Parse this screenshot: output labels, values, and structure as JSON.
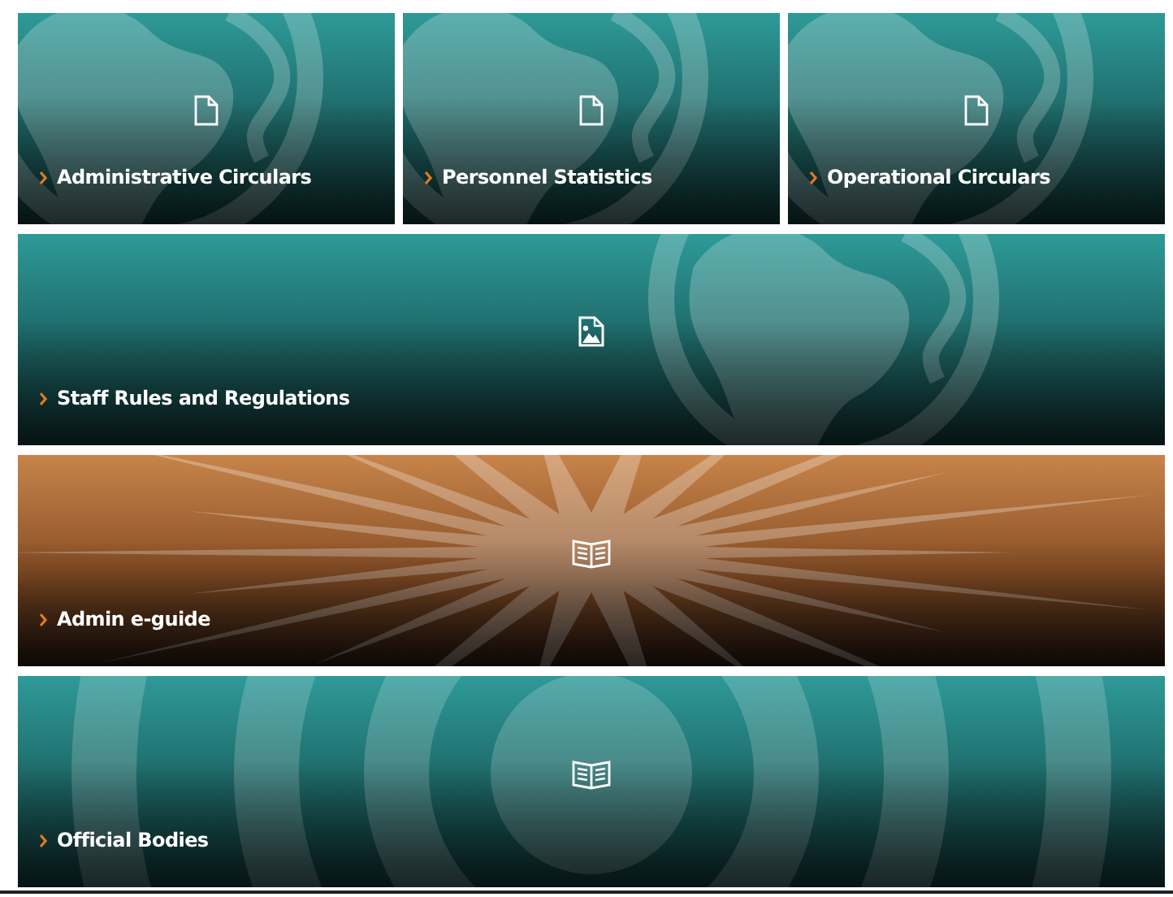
{
  "rows": [
    [
      {
        "label": "Administrative Circulars",
        "kind": "document"
      },
      {
        "label": "Personnel Statistics",
        "kind": "document"
      },
      {
        "label": "Operational Circulars",
        "kind": "document"
      }
    ],
    [
      {
        "label": "Staff Rules and Regulations",
        "kind": "image"
      }
    ],
    [
      {
        "label": "Admin e-guide",
        "kind": "book"
      }
    ],
    [
      {
        "label": "Official Bodies",
        "kind": "book"
      }
    ]
  ]
}
